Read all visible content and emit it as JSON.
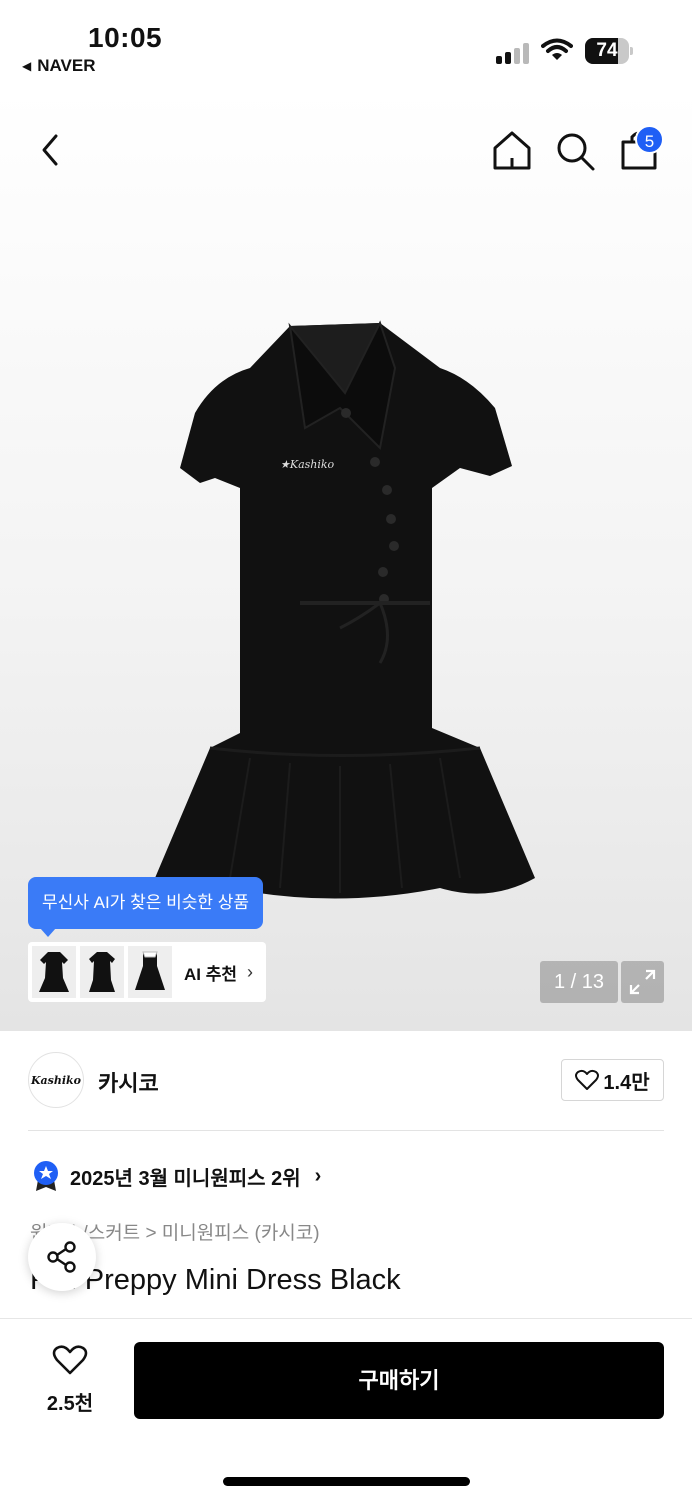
{
  "status_bar": {
    "time": "10:05",
    "back_app": "NAVER",
    "battery": "74",
    "battery_level": 0.74
  },
  "nav": {
    "icons": [
      "back-icon",
      "home-icon",
      "search-icon",
      "shopping-bag-icon"
    ],
    "cart_count": "5"
  },
  "gallery": {
    "ai_tooltip": "무신사 AI가 찾은 비슷한 상품",
    "ai_recommend_label": "AI 추천",
    "counter": "1 / 13"
  },
  "brand": {
    "logo_text": "Kashiko",
    "name": "카시코",
    "likes": "1.4만"
  },
  "ranking": {
    "text": "2025년 3월 미니원피스 2위"
  },
  "product": {
    "breadcrumb": "원피스/스커트 > 미니원피스 (카시코)",
    "title": "Fall Preppy Mini Dress Black"
  },
  "bottom_bar": {
    "wish_count": "2.5천",
    "buy_label": "구매하기"
  },
  "colors": {
    "accent_blue": "#3a7bf7",
    "badge_blue": "#1f5ff5",
    "buy_button": "#000000"
  }
}
